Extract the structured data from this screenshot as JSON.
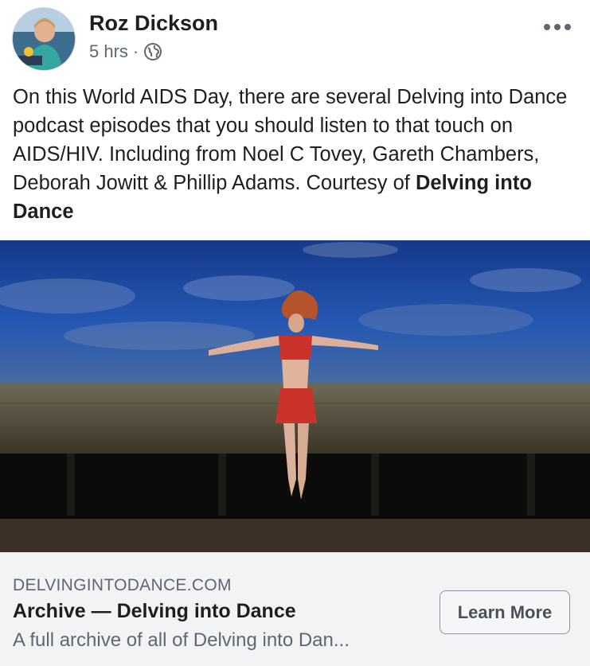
{
  "post": {
    "author": "Roz Dickson",
    "time": "5 hrs",
    "separator": "·",
    "privacy_icon": "globe-icon",
    "more_icon": "more-dots-icon",
    "text_main": "On this World AIDS Day, there are several Delving into Dance podcast episodes that you should listen to that touch on AIDS/HIV. Including from Noel C Tovey, Gareth Chambers, Deborah Jowitt & Phillip Adams. Courtesy of ",
    "text_bold": "Delving into Dance"
  },
  "link_card": {
    "domain": "DELVINGINTODANCE.COM",
    "title": "Archive — Delving into Dance",
    "description": "A full archive of all of Delving into Dan...",
    "cta_label": "Learn More"
  },
  "colors": {
    "sky": "#1f4fa8",
    "dancer_costume": "#c8322a",
    "card_bg": "#f2f3f5"
  }
}
